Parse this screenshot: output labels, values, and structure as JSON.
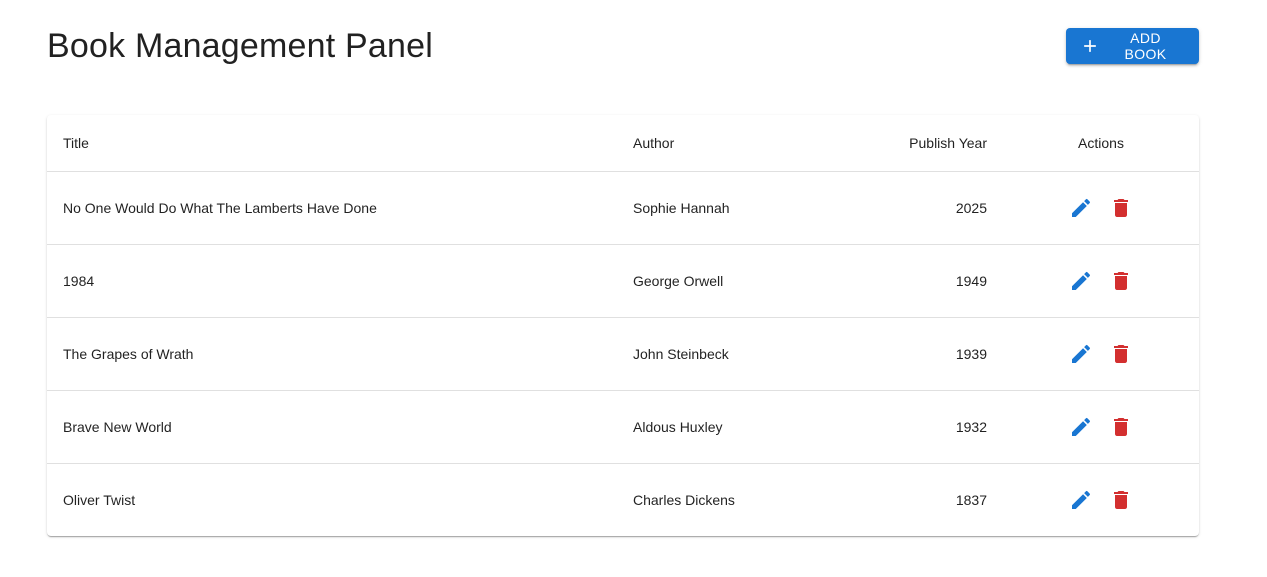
{
  "header": {
    "title": "Book Management Panel",
    "add_button_label": "Add Book"
  },
  "colors": {
    "primary": "#1976d2",
    "danger": "#d32f2f"
  },
  "icons": {
    "add": "plus-icon",
    "edit": "pencil-icon",
    "delete": "trash-icon"
  },
  "table": {
    "columns": {
      "title": "Title",
      "author": "Author",
      "year": "Publish Year",
      "actions": "Actions"
    },
    "rows": [
      {
        "title": "No One Would Do What The Lamberts Have Done",
        "author": "Sophie Hannah",
        "year": "2025"
      },
      {
        "title": "1984",
        "author": "George Orwell",
        "year": "1949"
      },
      {
        "title": "The Grapes of Wrath",
        "author": "John Steinbeck",
        "year": "1939"
      },
      {
        "title": "Brave New World",
        "author": "Aldous Huxley",
        "year": "1932"
      },
      {
        "title": "Oliver Twist",
        "author": "Charles Dickens",
        "year": "1837"
      }
    ]
  }
}
